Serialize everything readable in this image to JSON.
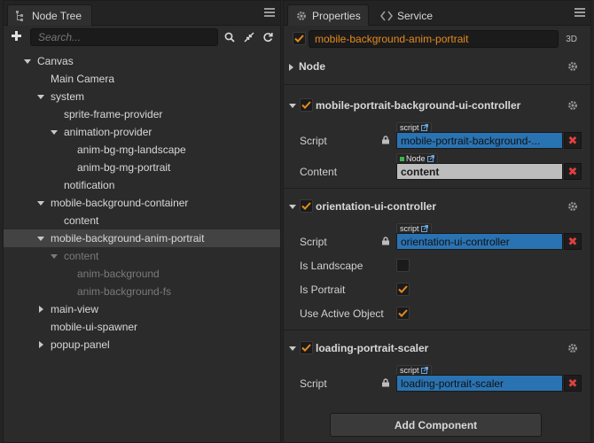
{
  "colors": {
    "accent": "#e58a1f",
    "script_field": "#2a73b2",
    "node_field": "#bdbdbd",
    "selected_row": "#434343",
    "remove": "#e04040"
  },
  "node_tree": {
    "tab_label": "Node Tree",
    "search_placeholder": "Search...",
    "items": [
      {
        "label": "Canvas",
        "expanded": true
      },
      {
        "label": "Main Camera"
      },
      {
        "label": "system",
        "expanded": true
      },
      {
        "label": "sprite-frame-provider"
      },
      {
        "label": "animation-provider",
        "expanded": true
      },
      {
        "label": "anim-bg-mg-landscape"
      },
      {
        "label": "anim-bg-mg-portrait"
      },
      {
        "label": "notification"
      },
      {
        "label": "mobile-background-container",
        "expanded": true
      },
      {
        "label": "content"
      },
      {
        "label": "mobile-background-anim-portrait",
        "expanded": true,
        "selected": true
      },
      {
        "label": "content",
        "expanded": true,
        "inactive": true
      },
      {
        "label": "anim-background",
        "inactive": true
      },
      {
        "label": "anim-background-fs",
        "inactive": true
      },
      {
        "label": "main-view",
        "collapsed": true
      },
      {
        "label": "mobile-ui-spawner"
      },
      {
        "label": "popup-panel",
        "collapsed": true
      }
    ]
  },
  "properties": {
    "tab_label": "Properties",
    "service_tab_label": "Service",
    "node_name": "mobile-background-anim-portrait",
    "badge_3d": "3D",
    "node_section": "Node",
    "components": [
      {
        "title": "mobile-portrait-background-ui-controller",
        "script_tag": "script",
        "script_label": "Script",
        "script_value": "mobile-portrait-background-...",
        "content_label": "Content",
        "content_tag": "Node",
        "content_value": "content"
      },
      {
        "title": "orientation-ui-controller",
        "script_tag": "script",
        "script_label": "Script",
        "script_value": "orientation-ui-controller",
        "is_landscape_label": "Is Landscape",
        "is_landscape": false,
        "is_portrait_label": "Is Portrait",
        "is_portrait": true,
        "use_active_object_label": "Use Active Object",
        "use_active_object": true
      },
      {
        "title": "loading-portrait-scaler",
        "script_tag": "script",
        "script_label": "Script",
        "script_value": "loading-portrait-scaler"
      }
    ],
    "add_component_label": "Add Component"
  }
}
